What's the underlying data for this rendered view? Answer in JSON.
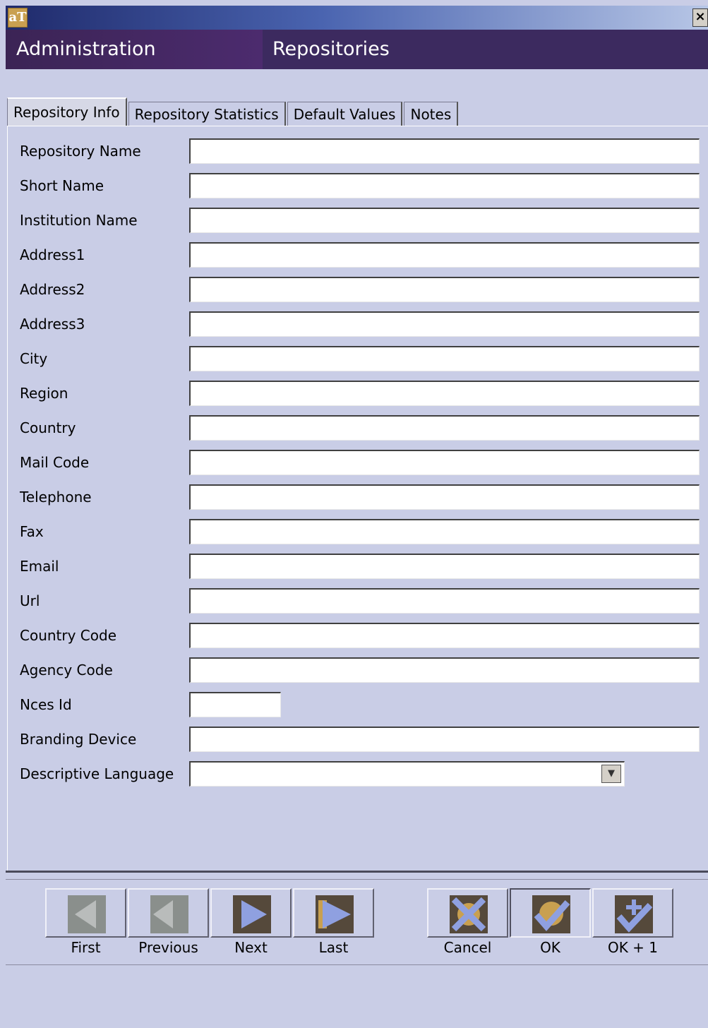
{
  "window": {
    "app_icon_text": "aT",
    "close_label": "×"
  },
  "header": {
    "section": "Administration",
    "title": "Repositories"
  },
  "tabs": [
    {
      "label": "Repository Info",
      "active": true
    },
    {
      "label": "Repository Statistics",
      "active": false
    },
    {
      "label": "Default Values",
      "active": false
    },
    {
      "label": "Notes",
      "active": false
    }
  ],
  "form": {
    "fields": [
      {
        "label": "Repository Name",
        "value": ""
      },
      {
        "label": "Short Name",
        "value": ""
      },
      {
        "label": "Institution Name",
        "value": ""
      },
      {
        "label": "Address1",
        "value": ""
      },
      {
        "label": "Address2",
        "value": ""
      },
      {
        "label": "Address3",
        "value": ""
      },
      {
        "label": "City",
        "value": ""
      },
      {
        "label": "Region",
        "value": ""
      },
      {
        "label": "Country",
        "value": ""
      },
      {
        "label": "Mail Code",
        "value": ""
      },
      {
        "label": "Telephone",
        "value": ""
      },
      {
        "label": "Fax",
        "value": ""
      },
      {
        "label": "Email",
        "value": ""
      },
      {
        "label": "Url",
        "value": ""
      },
      {
        "label": "Country Code",
        "value": ""
      },
      {
        "label": "Agency Code",
        "value": ""
      },
      {
        "label": "Nces Id",
        "value": ""
      },
      {
        "label": "Branding Device",
        "value": ""
      },
      {
        "label": "Descriptive Language",
        "value": ""
      }
    ]
  },
  "navigation": {
    "first": "First",
    "previous": "Previous",
    "next": "Next",
    "last": "Last"
  },
  "actions": {
    "cancel": "Cancel",
    "ok": "OK",
    "ok_plus_one": "OK + 1"
  },
  "colors": {
    "background": "#c9cde6",
    "header": "#3c2a5f",
    "icon_active": "#55493b",
    "icon_arrow": "#8fa0e0",
    "icon_disabled": "#8a8f8c"
  }
}
